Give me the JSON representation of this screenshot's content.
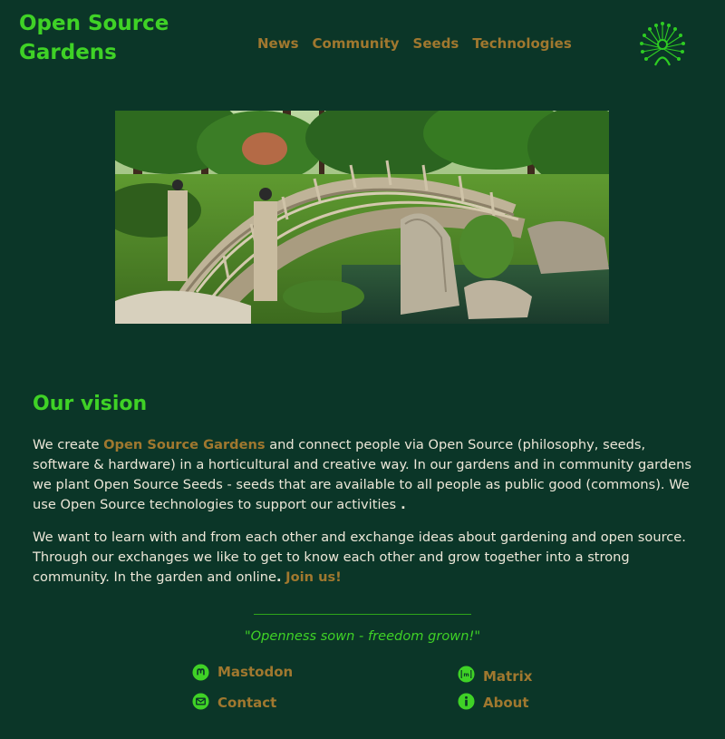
{
  "header": {
    "title_line1": "Open Source",
    "title_line2": "Gardens",
    "logo_icon": "dandelion-person-icon",
    "nav": [
      {
        "label": "News"
      },
      {
        "label": "Community"
      },
      {
        "label": "Seeds"
      },
      {
        "label": "Technologies"
      }
    ]
  },
  "hero": {
    "icon": "garden-bridge-image"
  },
  "vision": {
    "heading": "Our vision",
    "p1_start": "We create ",
    "p1_highlight": "Open Source Gardens",
    "p1_rest": " and connect people via Open Source (philosophy, seeds, software & hardware) in a horticultural and creative way. In our gardens and in community gardens we plant Open Source Seeds - seeds that are available to all people as public good (commons). We use Open Source technologies to support our activities",
    "p1_end": " .",
    "p2_text": "We want to learn with and from each other and exchange ideas about gardening and open source. Through our exchanges we like to get to know each other and grow together into a strong community. In the garden and online",
    "p2_dot": ".",
    "p2_link": "Join us!"
  },
  "footer": {
    "motto": "\"Openness sown - freedom grown!\"",
    "links": [
      {
        "label": "Mastodon",
        "icon": "mastodon-icon"
      },
      {
        "label": "Matrix",
        "icon": "matrix-icon"
      },
      {
        "label": "Contact",
        "icon": "mail-icon"
      },
      {
        "label": "About",
        "icon": "info-icon"
      }
    ]
  },
  "colors": {
    "background": "#0b3628",
    "accent_green": "#3fd226",
    "link_brown": "#a0782f",
    "text": "#ece7d8"
  }
}
